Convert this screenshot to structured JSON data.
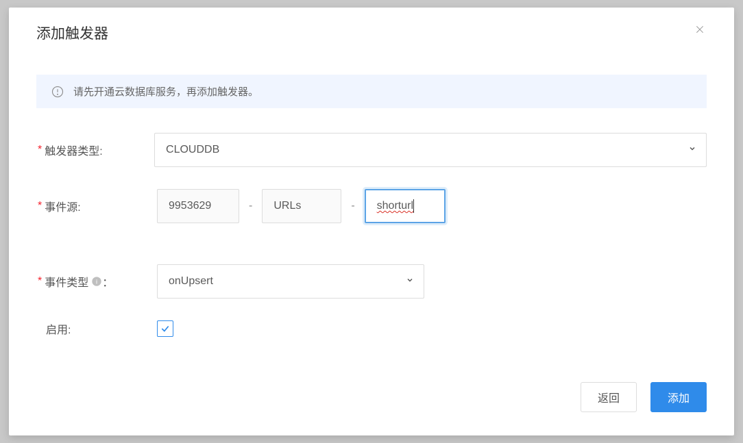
{
  "modal": {
    "title": "添加触发器",
    "alert": "请先开通云数据库服务，再添加触发器。",
    "fields": {
      "triggerType": {
        "label": "触发器类型:",
        "value": "CLOUDDB"
      },
      "eventSource": {
        "label": "事件源:",
        "part1": "9953629",
        "part2": "URLs",
        "part3": "shorturl"
      },
      "eventType": {
        "label": "事件类型",
        "labelSuffix": "：",
        "value": "onUpsert"
      },
      "enable": {
        "label": "启用:",
        "checked": true
      }
    },
    "buttons": {
      "back": "返回",
      "add": "添加"
    }
  }
}
